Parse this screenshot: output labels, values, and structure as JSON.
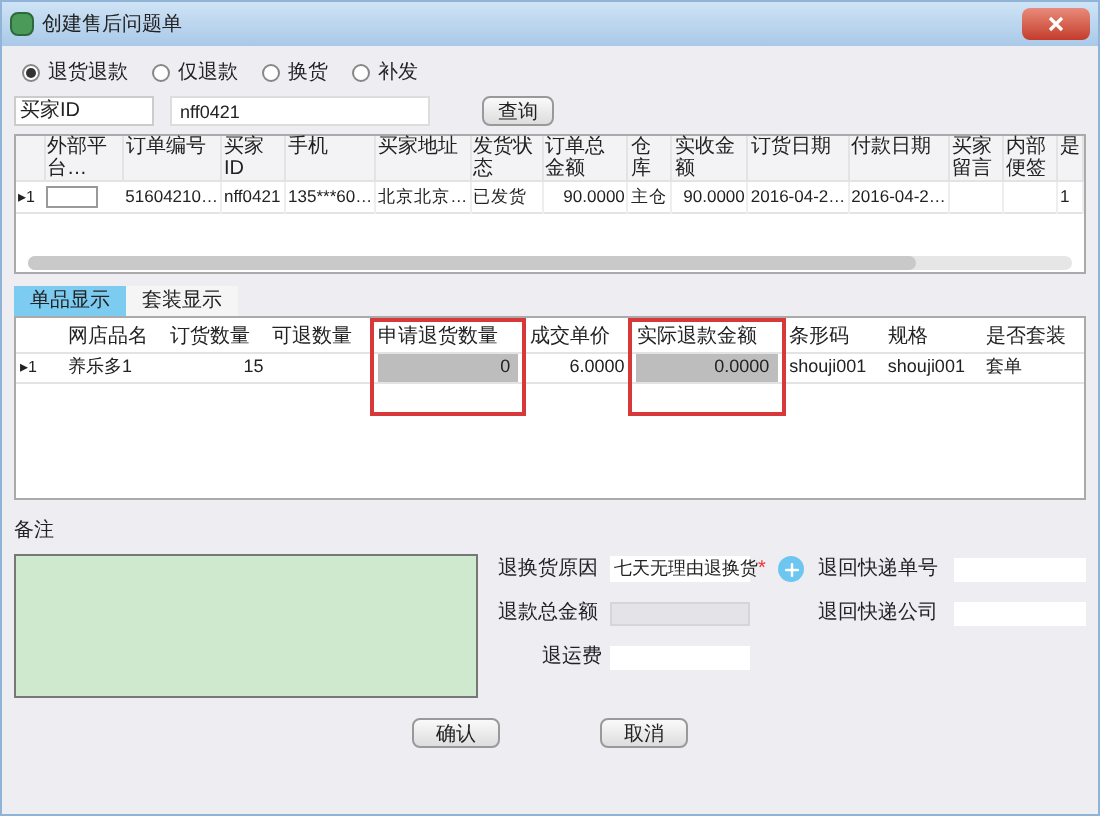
{
  "window": {
    "title": "创建售后问题单"
  },
  "modes": [
    {
      "label": "退货退款",
      "selected": true
    },
    {
      "label": "仅退款",
      "selected": false
    },
    {
      "label": "换货",
      "selected": false
    },
    {
      "label": "补发",
      "selected": false
    }
  ],
  "search": {
    "field": "买家ID",
    "value": "nff0421",
    "button": "查询"
  },
  "orders": {
    "columns": [
      "外部平台…",
      "订单编号",
      "买家ID",
      "手机",
      "买家地址",
      "发货状态",
      "订单总金额",
      "仓库",
      "实收金额",
      "订货日期",
      "付款日期",
      "买家留言",
      "内部便签",
      "是"
    ],
    "rows": [
      {
        "marker": "▸",
        "index": "1",
        "cells": [
          "",
          "51604210…",
          "nff0421",
          "135***60…",
          "北京北京…",
          "已发货",
          "90.0000",
          "主仓",
          "90.0000",
          "2016-04-2…",
          "2016-04-2…",
          "",
          "",
          "1"
        ]
      }
    ]
  },
  "tabs": [
    {
      "label": "单品显示",
      "selected": true
    },
    {
      "label": "套装显示",
      "selected": false
    }
  ],
  "items": {
    "columns": [
      {
        "label": "网店品名",
        "highlighted": false
      },
      {
        "label": "订货数量",
        "highlighted": false
      },
      {
        "label": "可退数量",
        "highlighted": false
      },
      {
        "label": "申请退货数量",
        "highlighted": true
      },
      {
        "label": "成交单价",
        "highlighted": false
      },
      {
        "label": "实际退款金额",
        "highlighted": true
      },
      {
        "label": "条形码",
        "highlighted": false
      },
      {
        "label": "规格",
        "highlighted": false
      },
      {
        "label": "是否套装",
        "highlighted": false
      }
    ],
    "rows": [
      {
        "marker": "▸",
        "index": "1",
        "cells": [
          "养乐多1",
          "15",
          "",
          "0",
          "6.0000",
          "0.0000",
          "shouji001",
          "shouji001",
          "套单"
        ]
      }
    ]
  },
  "note": {
    "label": "备注"
  },
  "form": {
    "reason_label": "退换货原因",
    "reason_value": "七天无理由退换货",
    "required_mark": "*",
    "refund_total_label": "退款总金额",
    "shipping_fee_label": "退运费",
    "tracking_label": "退回快递单号",
    "courier_label": "退回快递公司"
  },
  "buttons": [
    "确认",
    "取消"
  ]
}
